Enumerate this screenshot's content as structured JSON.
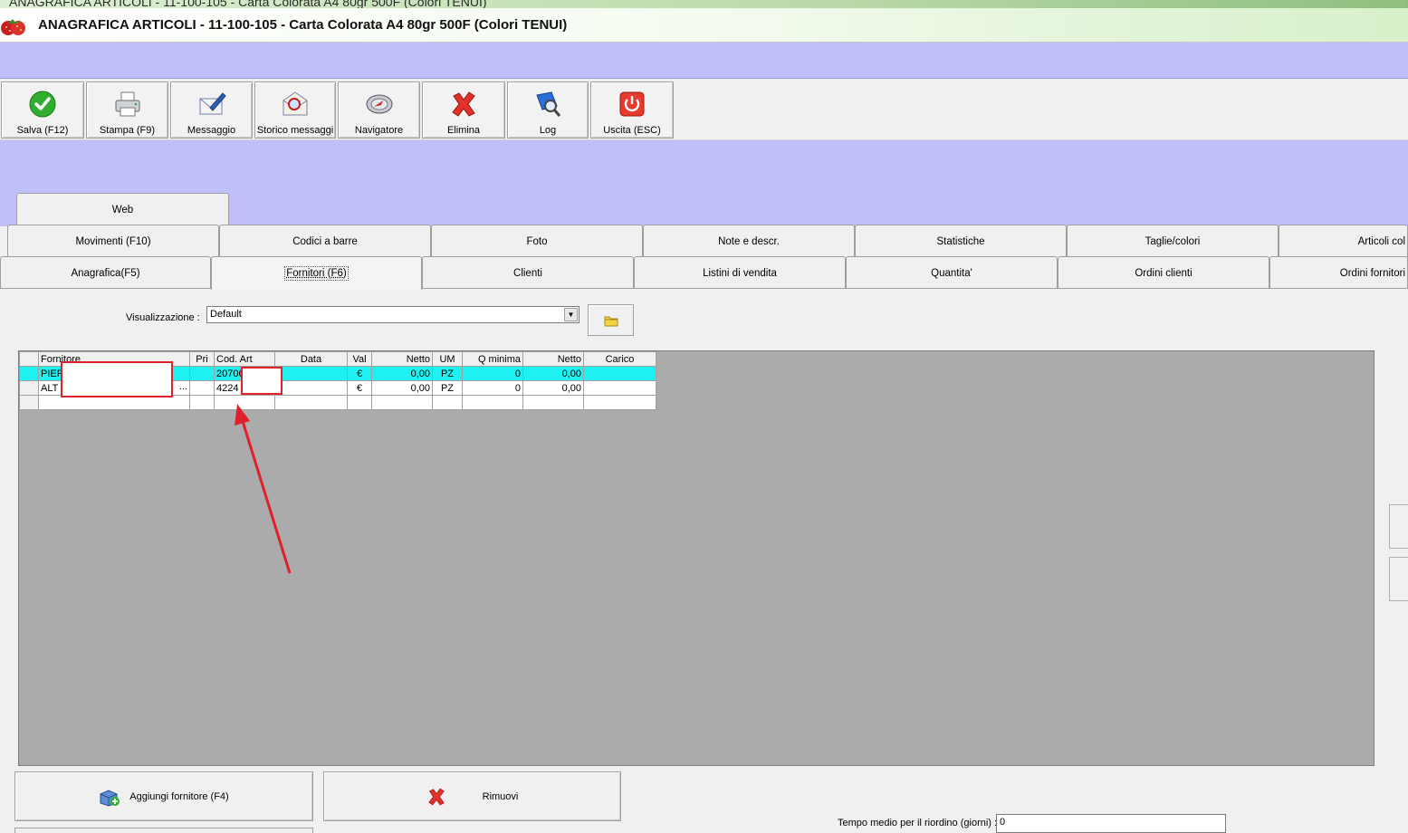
{
  "window": {
    "background_title": "ANAGRAFICA ARTICOLI - 11-100-105 - Carta Colorata A4  80gr 500F (Colori TENUI)",
    "title": "ANAGRAFICA ARTICOLI - 11-100-105 - Carta Colorata A4  80gr 500F (Colori TENUI)",
    "icon": "strawberry-icon"
  },
  "toolbar": {
    "buttons": [
      {
        "label": "Salva (F12)",
        "icon": "check-icon"
      },
      {
        "label": "Stampa (F9)",
        "icon": "printer-icon"
      },
      {
        "label": "Messaggio",
        "icon": "pen-envelope-icon"
      },
      {
        "label": "Storico messaggi",
        "icon": "envelope-search-icon"
      },
      {
        "label": "Navigatore",
        "icon": "navigator-icon"
      },
      {
        "label": "Elimina",
        "icon": "delete-x-icon"
      },
      {
        "label": "Log",
        "icon": "log-book-icon"
      },
      {
        "label": "Uscita (ESC)",
        "icon": "power-icon"
      }
    ]
  },
  "tabs": {
    "row1": [
      "Web"
    ],
    "row2": [
      "Movimenti (F10)",
      "Codici a barre",
      "Foto",
      "Note e descr.",
      "Statistiche",
      "Taglie/colori",
      "Articoli col"
    ],
    "row3": [
      "Anagrafica(F5)",
      "Fornitori (F6)",
      "Clienti",
      "Listini di vendita",
      "Quantita'",
      "Ordini clienti",
      "Ordini fornitori"
    ],
    "active": "Fornitori (F6)"
  },
  "visualizzazione": {
    "label": "Visualizzazione :",
    "value": "Default"
  },
  "grid": {
    "columns": [
      "Fornitore",
      "Pri",
      "Cod. Art",
      "Data",
      "Val",
      "Netto",
      "UM",
      "Q minima",
      "Netto",
      "Carico"
    ],
    "rows": [
      {
        "fornitore": "PIER",
        "pri": "",
        "cod_art": "20706",
        "data": "",
        "val": "€",
        "netto": "0,00",
        "um": "PZ",
        "q_minima": "0",
        "netto2": "0,00",
        "carico": "",
        "selected": true
      },
      {
        "fornitore": "ALT",
        "pri": "",
        "cod_art": "4224",
        "data": "",
        "val": "€",
        "netto": "0,00",
        "um": "PZ",
        "q_minima": "0",
        "netto2": "0,00",
        "carico": "",
        "selected": false
      }
    ],
    "fornitore_trailing": "..."
  },
  "buttons": {
    "aggiungi": "Aggiungi fornitore (F4)",
    "rimuovi": "Rimuovi"
  },
  "riordino": {
    "label": "Tempo medio per il riordino (giorni) :",
    "value": "0"
  },
  "colors": {
    "band": "#bfbffc",
    "selected_row": "#1ff1f1",
    "annotation": "#e0202a"
  }
}
